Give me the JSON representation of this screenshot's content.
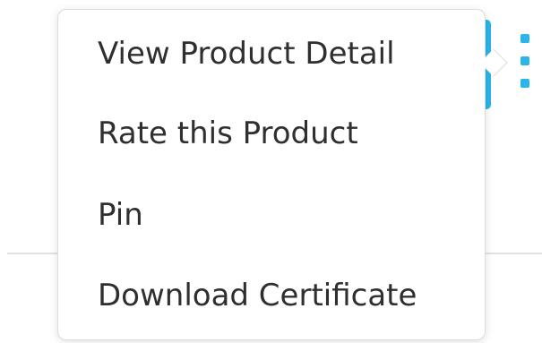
{
  "menu": {
    "items": [
      {
        "label": "View Product Detail"
      },
      {
        "label": "Rate this Product"
      },
      {
        "label": "Pin"
      },
      {
        "label": "Download Certificate"
      }
    ]
  },
  "colors": {
    "accent": "#2bb5ea",
    "menu_text": "#2f2f2f",
    "menu_border": "#dcdcdc",
    "divider": "#e2e2e2"
  },
  "icons": {
    "more": "kebab-menu-icon"
  }
}
